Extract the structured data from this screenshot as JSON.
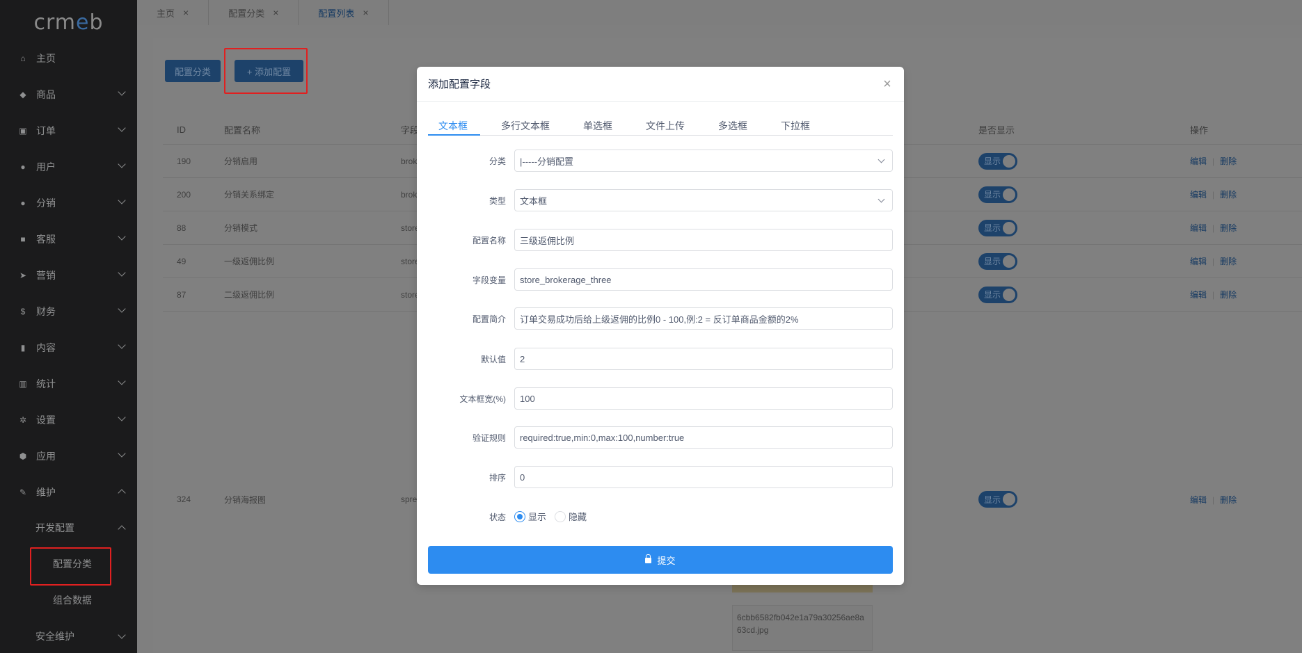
{
  "logo_text": "crmeb",
  "sidebar": {
    "items": [
      {
        "label": "主页",
        "icon": "home-icon"
      },
      {
        "label": "商品",
        "icon": "basket-icon"
      },
      {
        "label": "订单",
        "icon": "cart-icon"
      },
      {
        "label": "用户",
        "icon": "user-icon"
      },
      {
        "label": "分销",
        "icon": "group-icon"
      },
      {
        "label": "客服",
        "icon": "chat-icon"
      },
      {
        "label": "营销",
        "icon": "send-icon"
      },
      {
        "label": "财务",
        "icon": "dollar-icon"
      },
      {
        "label": "内容",
        "icon": "book-icon"
      },
      {
        "label": "统计",
        "icon": "bar-chart-icon"
      },
      {
        "label": "设置",
        "icon": "gear-icon"
      },
      {
        "label": "应用",
        "icon": "package-icon"
      },
      {
        "label": "维护",
        "icon": "wrench-icon"
      }
    ],
    "sub_dev": "开发配置",
    "leaf_config_category": "配置分类",
    "leaf_combo_data": "组合数据",
    "sub_security": "安全维护"
  },
  "tabs": [
    {
      "label": "主页"
    },
    {
      "label": "配置分类"
    },
    {
      "label": "配置列表"
    }
  ],
  "toolbar": {
    "config_category_btn": "配置分类",
    "add_config_btn": "+ 添加配置"
  },
  "table": {
    "headers": {
      "id": "ID",
      "name": "配置名称",
      "field": "字段",
      "show": "是否显示",
      "op": "操作"
    },
    "rows": [
      {
        "id": "190",
        "name": "分销启用",
        "field": "brok"
      },
      {
        "id": "200",
        "name": "分销关系绑定",
        "field": "brok"
      },
      {
        "id": "88",
        "name": "分销模式",
        "field": "store"
      },
      {
        "id": "49",
        "name": "一级返佣比例",
        "field": "store"
      },
      {
        "id": "87",
        "name": "二级返佣比例",
        "field": "store"
      },
      {
        "id": "324",
        "name": "分销海报图",
        "field": "spre"
      }
    ],
    "switch_label": "显示",
    "edit_label": "编辑",
    "delete_label": "删除",
    "image_filename": "6cbb6582fb042e1a79a30256ae8a63cd.jpg"
  },
  "modal": {
    "title": "添加配置字段",
    "close": "×",
    "tabs": [
      "文本框",
      "多行文本框",
      "单选框",
      "文件上传",
      "多选框",
      "下拉框"
    ],
    "fields": {
      "category": {
        "label": "分类",
        "value": "|-----分销配置"
      },
      "type": {
        "label": "类型",
        "value": "文本框"
      },
      "name": {
        "label": "配置名称",
        "value": "三级返佣比例"
      },
      "var": {
        "label": "字段变量",
        "value": "store_brokerage_three"
      },
      "desc": {
        "label": "配置简介",
        "value": "订单交易成功后给上级返佣的比例0 - 100,例:2 = 反订单商品金额的2%"
      },
      "default": {
        "label": "默认值",
        "value": "2"
      },
      "width": {
        "label": "文本框宽(%)",
        "value": "100"
      },
      "rule": {
        "label": "验证规则",
        "value": "required:true,min:0,max:100,number:true"
      },
      "sort": {
        "label": "排序",
        "value": "0"
      },
      "status": {
        "label": "状态",
        "option_show": "显示",
        "option_hide": "隐藏"
      }
    },
    "submit": "提交"
  },
  "colors": {
    "primary": "#2d8cf0",
    "sidebar_bg": "#1b1b1c",
    "highlight": "#e02020"
  }
}
